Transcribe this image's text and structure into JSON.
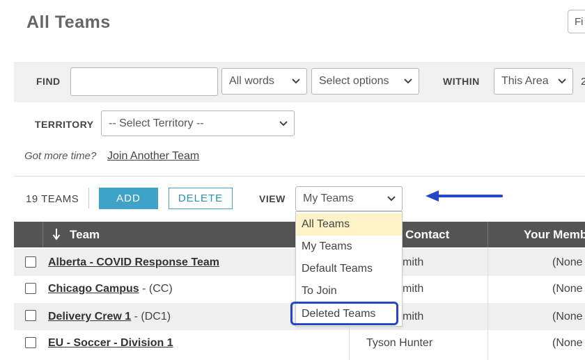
{
  "page": {
    "title": "All Teams",
    "top_button_label": "Fi"
  },
  "find": {
    "find_label": "FIND",
    "find_value": "",
    "match_select": "All words",
    "options_select": "Select options",
    "within_label": "WITHIN",
    "within_select": "This Area",
    "edge_char": "2"
  },
  "territory": {
    "label": "TERRITORY",
    "select": "-- Select Territory --"
  },
  "join": {
    "prompt": "Got more time?",
    "link": "Join Another Team"
  },
  "toolbar": {
    "count": "19 TEAMS",
    "add_label": "ADD",
    "delete_label": "DELETE",
    "view_label": "VIEW",
    "view_value": "My Teams"
  },
  "view_options": [
    "All Teams",
    "My Teams",
    "Default Teams",
    "To Join",
    "Deleted Teams"
  ],
  "view_highlighted": "All Teams",
  "annotation_highlighted_option": "Deleted Teams",
  "table": {
    "columns": {
      "team": "Team",
      "contact": "Contact",
      "membership": "Your Member"
    },
    "rows": [
      {
        "team": "Alberta - COVID Response Team",
        "code": "",
        "contact": "mith",
        "membership": "(None"
      },
      {
        "team": "Chicago Campus",
        "code": " - (CC)",
        "contact": "mith",
        "membership": "(None"
      },
      {
        "team": "Delivery Crew 1",
        "code": " - (DC1)",
        "contact": "mith",
        "membership": "(None"
      },
      {
        "team": "EU - Soccer - Division 1",
        "code": "",
        "contact": "Tyson Hunter",
        "membership": "(None"
      }
    ]
  },
  "colors": {
    "accent": "#3fa2c9",
    "header": "#545454",
    "annotation": "#2347c9",
    "dropdown_highlight": "#fdf3c7"
  },
  "icons": [
    "chevron-down-icon",
    "sort-arrow-icon",
    "arrow-left-icon"
  ]
}
